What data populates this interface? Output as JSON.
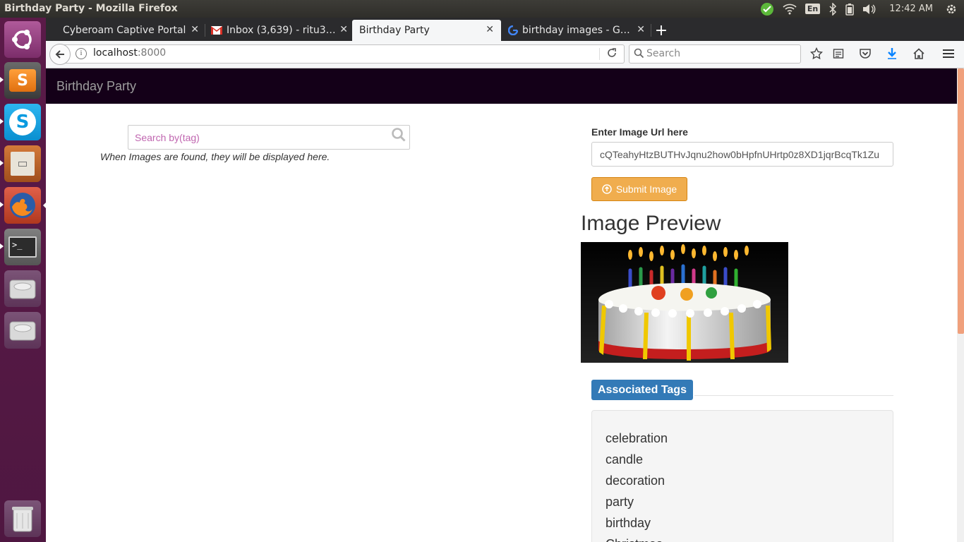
{
  "window": {
    "title": "Birthday Party - Mozilla Firefox"
  },
  "tray": {
    "keyboard": "En",
    "time": "12:42 AM"
  },
  "launcher": {
    "items": [
      "ubuntu-dash",
      "sublime-text",
      "skype",
      "files",
      "firefox",
      "terminal",
      "drive-1",
      "drive-2",
      "trash"
    ]
  },
  "tabs": [
    {
      "label": "Cyberoam Captive Portal",
      "close": "✕"
    },
    {
      "label": "Inbox (3,639) - ritu3…",
      "close": "✕"
    },
    {
      "label": "Birthday Party",
      "close": "✕"
    },
    {
      "label": "birthday images - G…",
      "close": "✕"
    }
  ],
  "new_tab": "+",
  "urlbar": {
    "host": "localhost",
    "port": ":8000"
  },
  "searchbar": {
    "placeholder": "Search"
  },
  "app": {
    "brand": "Birthday Party",
    "search": {
      "placeholder": "Search by(tag)"
    },
    "empty_message": "When Images are found, they will be displayed here.",
    "url_label": "Enter Image Url here",
    "url_value": "cQTeahyHtzBUTHvJqnu2how0bHpfnUHrtp0z8XD1jqrBcqTk1Zu",
    "submit_label": "Submit Image",
    "preview_title": "Image Preview",
    "tags_title": "Associated Tags",
    "tags": [
      "celebration",
      "candle",
      "decoration",
      "party",
      "birthday",
      "Christmas"
    ]
  },
  "colors": {
    "navbar": "#140018",
    "submit": "#f0ad4e",
    "tags_legend": "#337ab7",
    "launcher": "#5b1a48"
  }
}
